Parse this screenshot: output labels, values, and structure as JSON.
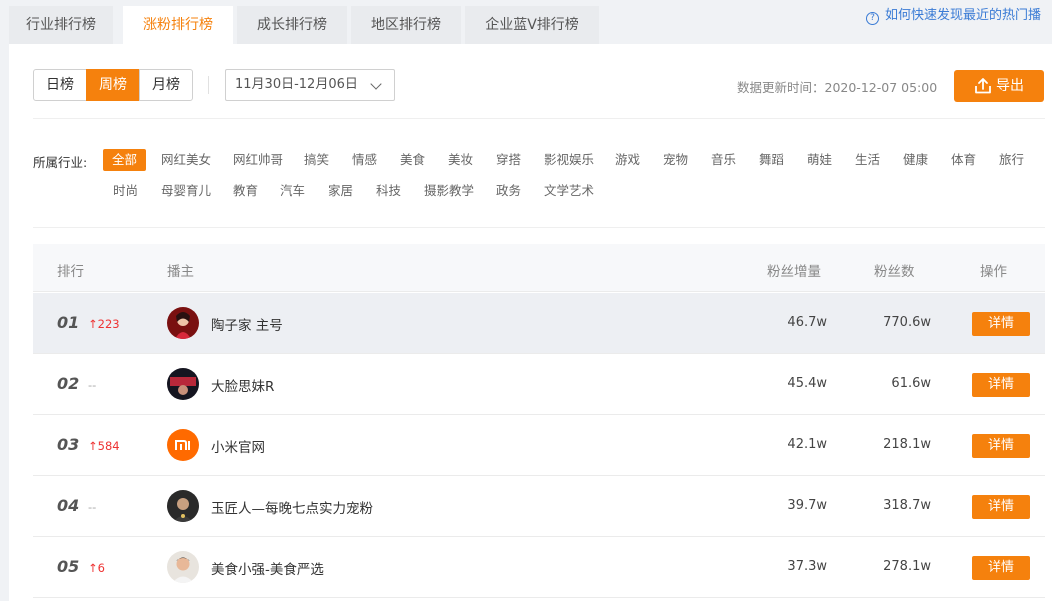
{
  "tabs": [
    "行业排行榜",
    "涨粉排行榜",
    "成长排行榜",
    "地区排行榜",
    "企业蓝V排行榜"
  ],
  "active_tab": 1,
  "help_text": "如何快速发现最近的热门播",
  "period_tabs": [
    "日榜",
    "周榜",
    "月榜"
  ],
  "active_period": 1,
  "date_range": "11月30日-12月06日",
  "update_label": "数据更新时间：2020-12-07 05:00",
  "export_label": "导出",
  "industry_label": "所属行业:",
  "industries_row1": [
    "全部",
    "网红美女",
    "网红帅哥",
    "搞笑",
    "情感",
    "美食",
    "美妆",
    "穿搭",
    "影视娱乐",
    "游戏",
    "宠物",
    "音乐",
    "舞蹈",
    "萌娃",
    "生活",
    "健康",
    "体育",
    "旅行"
  ],
  "industries_row2": [
    "时尚",
    "母婴育儿",
    "教育",
    "汽车",
    "家居",
    "科技",
    "摄影教学",
    "政务",
    "文学艺术"
  ],
  "table_headers": {
    "rank": "排行",
    "host": "播主",
    "increase": "粉丝增量",
    "fans": "粉丝数",
    "action": "操作"
  },
  "rows": [
    {
      "rank": "01",
      "change": "↑223",
      "name": "陶子家 主号",
      "increase": "46.7w",
      "fans": "770.6w",
      "action": "详情"
    },
    {
      "rank": "02",
      "change": "--",
      "name": "大脸思妹R",
      "increase": "45.4w",
      "fans": "61.6w",
      "action": "详情"
    },
    {
      "rank": "03",
      "change": "↑584",
      "name": "小米官网",
      "increase": "42.1w",
      "fans": "218.1w",
      "action": "详情"
    },
    {
      "rank": "04",
      "change": "--",
      "name": "玉匠人—每晚七点实力宠粉",
      "increase": "39.7w",
      "fans": "318.7w",
      "action": "详情"
    },
    {
      "rank": "05",
      "change": "↑6",
      "name": "美食小强-美食严选",
      "increase": "37.3w",
      "fans": "278.1w",
      "action": "详情"
    }
  ]
}
